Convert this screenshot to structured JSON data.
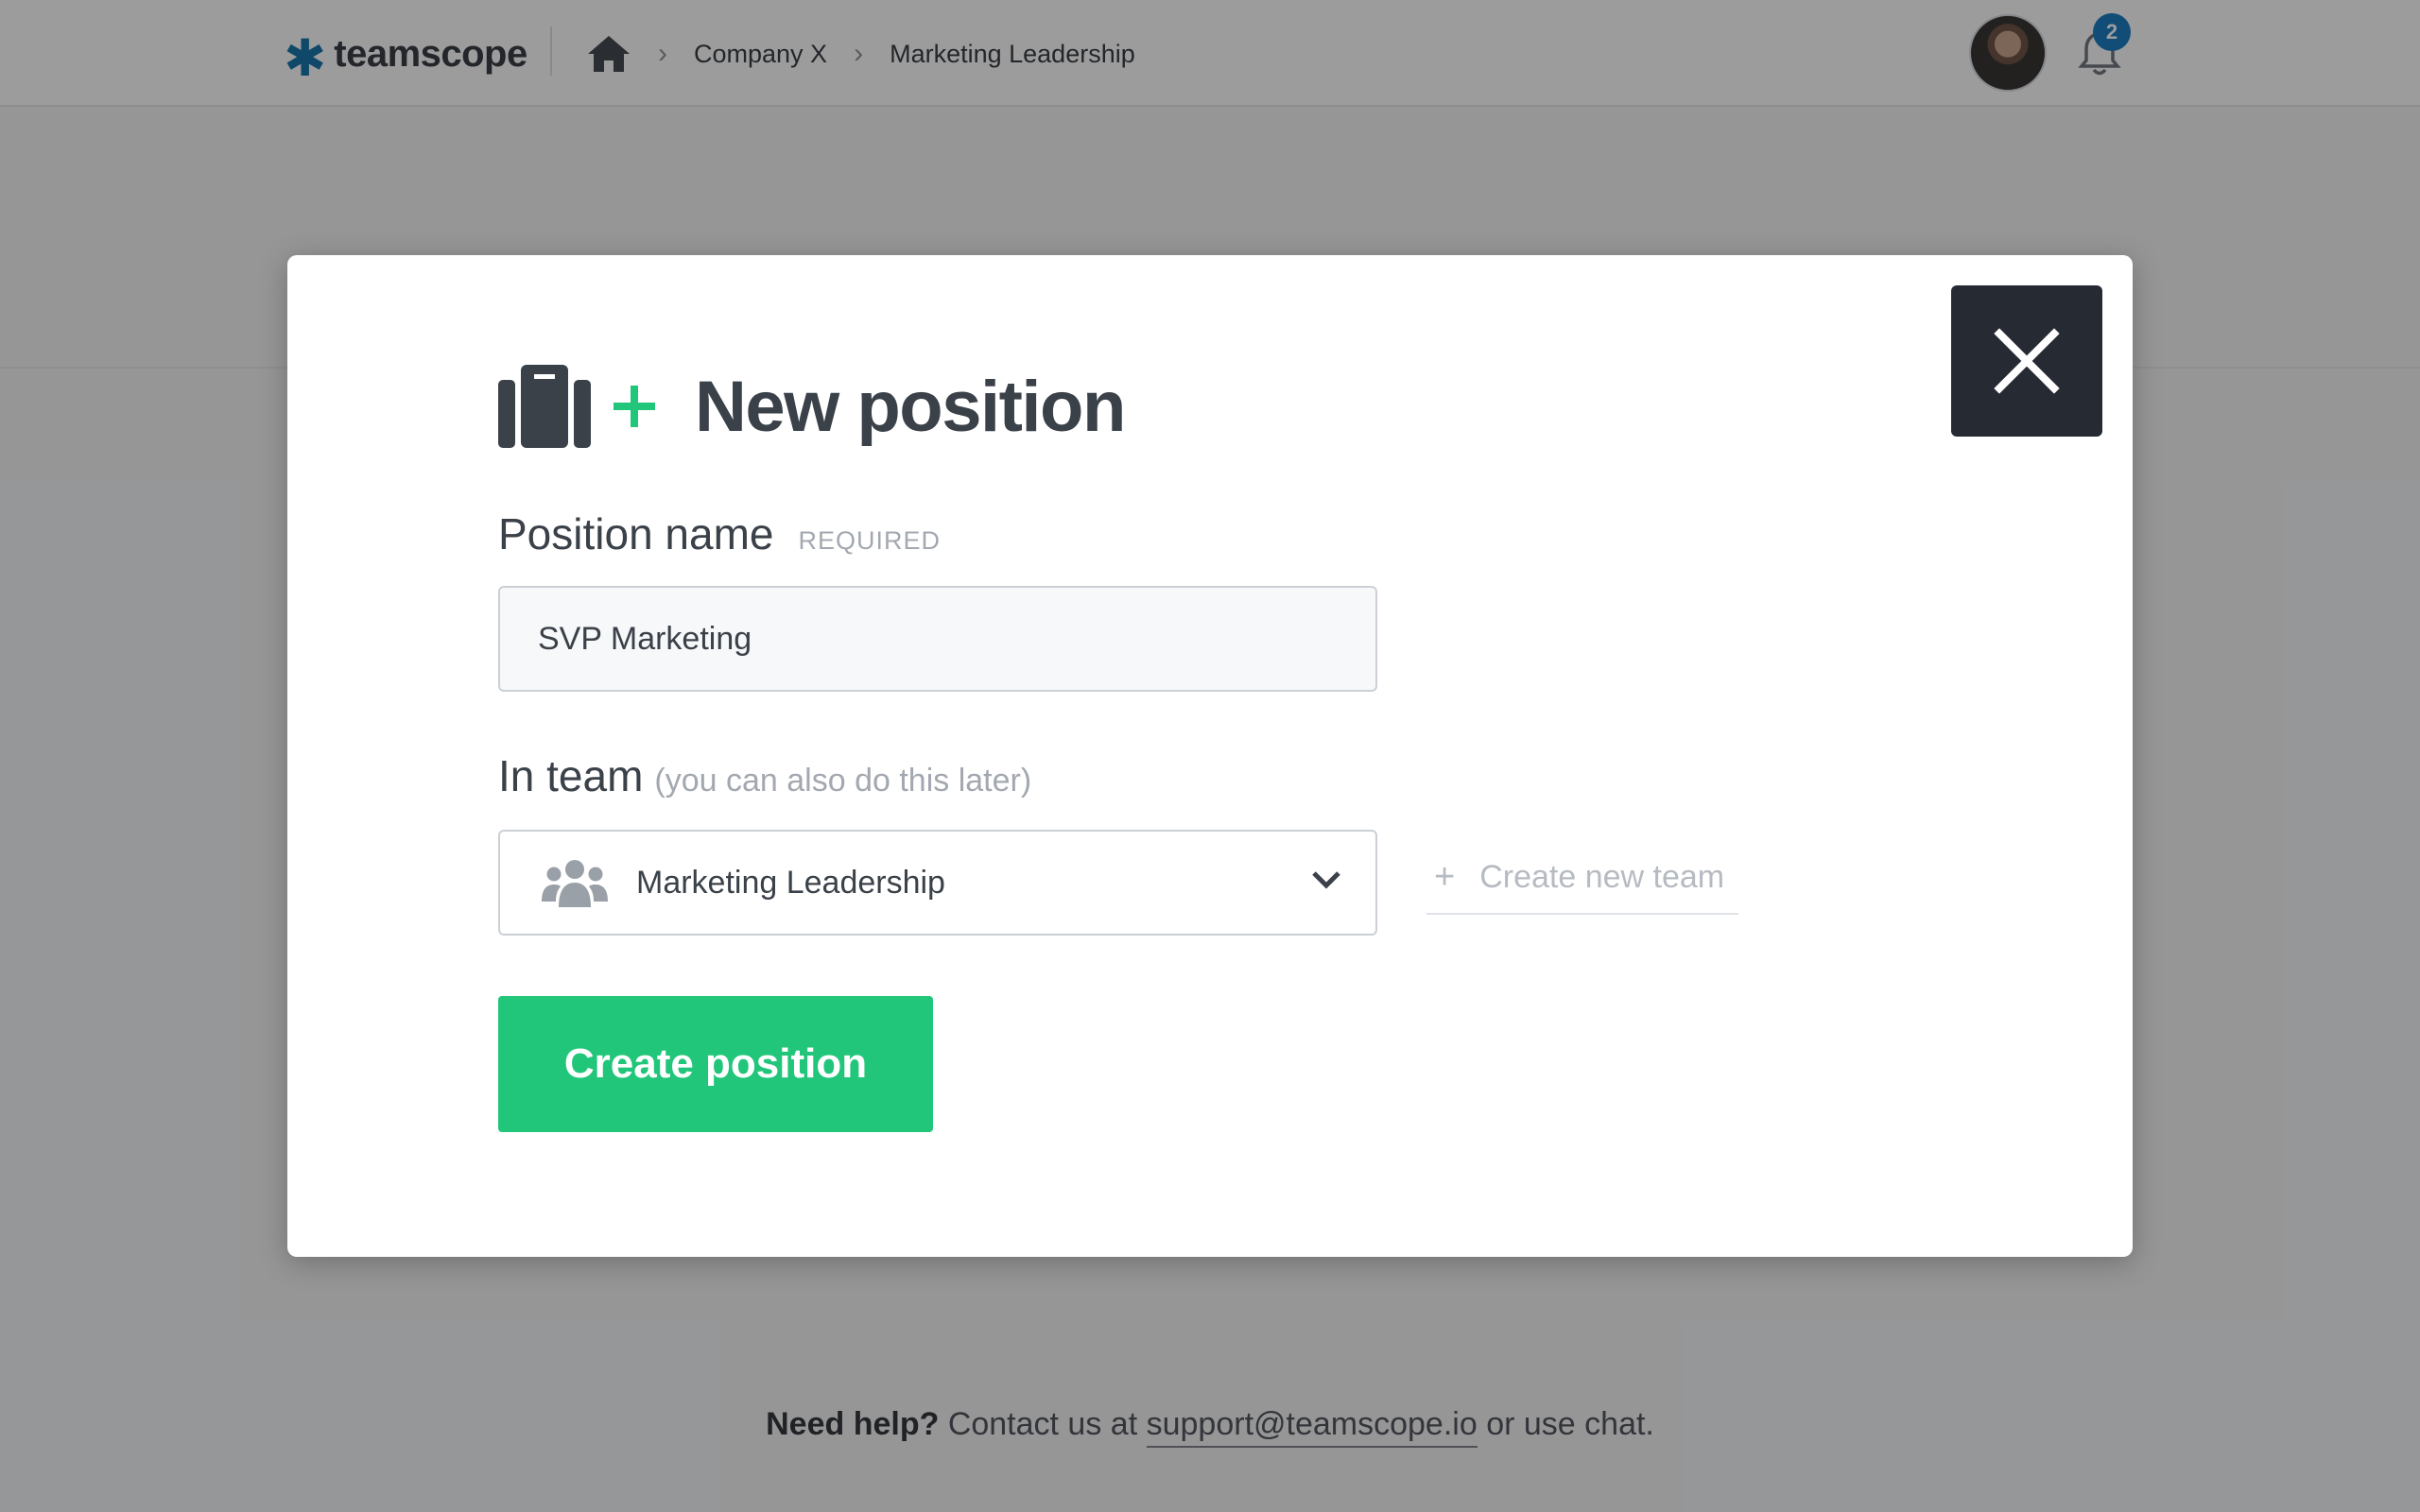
{
  "header": {
    "logo_text": "teamscope",
    "breadcrumb": [
      "Company X",
      "Marketing Leadership"
    ],
    "notification_count": "2"
  },
  "modal": {
    "title": "New position",
    "position_name_label": "Position name",
    "required_tag": "REQUIRED",
    "position_name_value": "SVP Marketing",
    "team_label": "In team",
    "team_hint": "(you can also do this later)",
    "team_selected": "Marketing Leadership",
    "create_team_label": "Create new team",
    "submit_label": "Create position"
  },
  "footer": {
    "help_bold": "Need help?",
    "help_text": "Contact us at",
    "email": "support@teamscope.io",
    "help_suffix": "or use chat."
  },
  "icons": [
    "home-icon",
    "chevron-right-icon",
    "bell-icon",
    "briefcase-icon",
    "plus-icon",
    "close-icon",
    "users-icon",
    "chevron-down-icon"
  ],
  "colors": {
    "brand_blue": "#0d6fa8",
    "accent_green": "#22c67b",
    "close_bg": "#262a33"
  }
}
